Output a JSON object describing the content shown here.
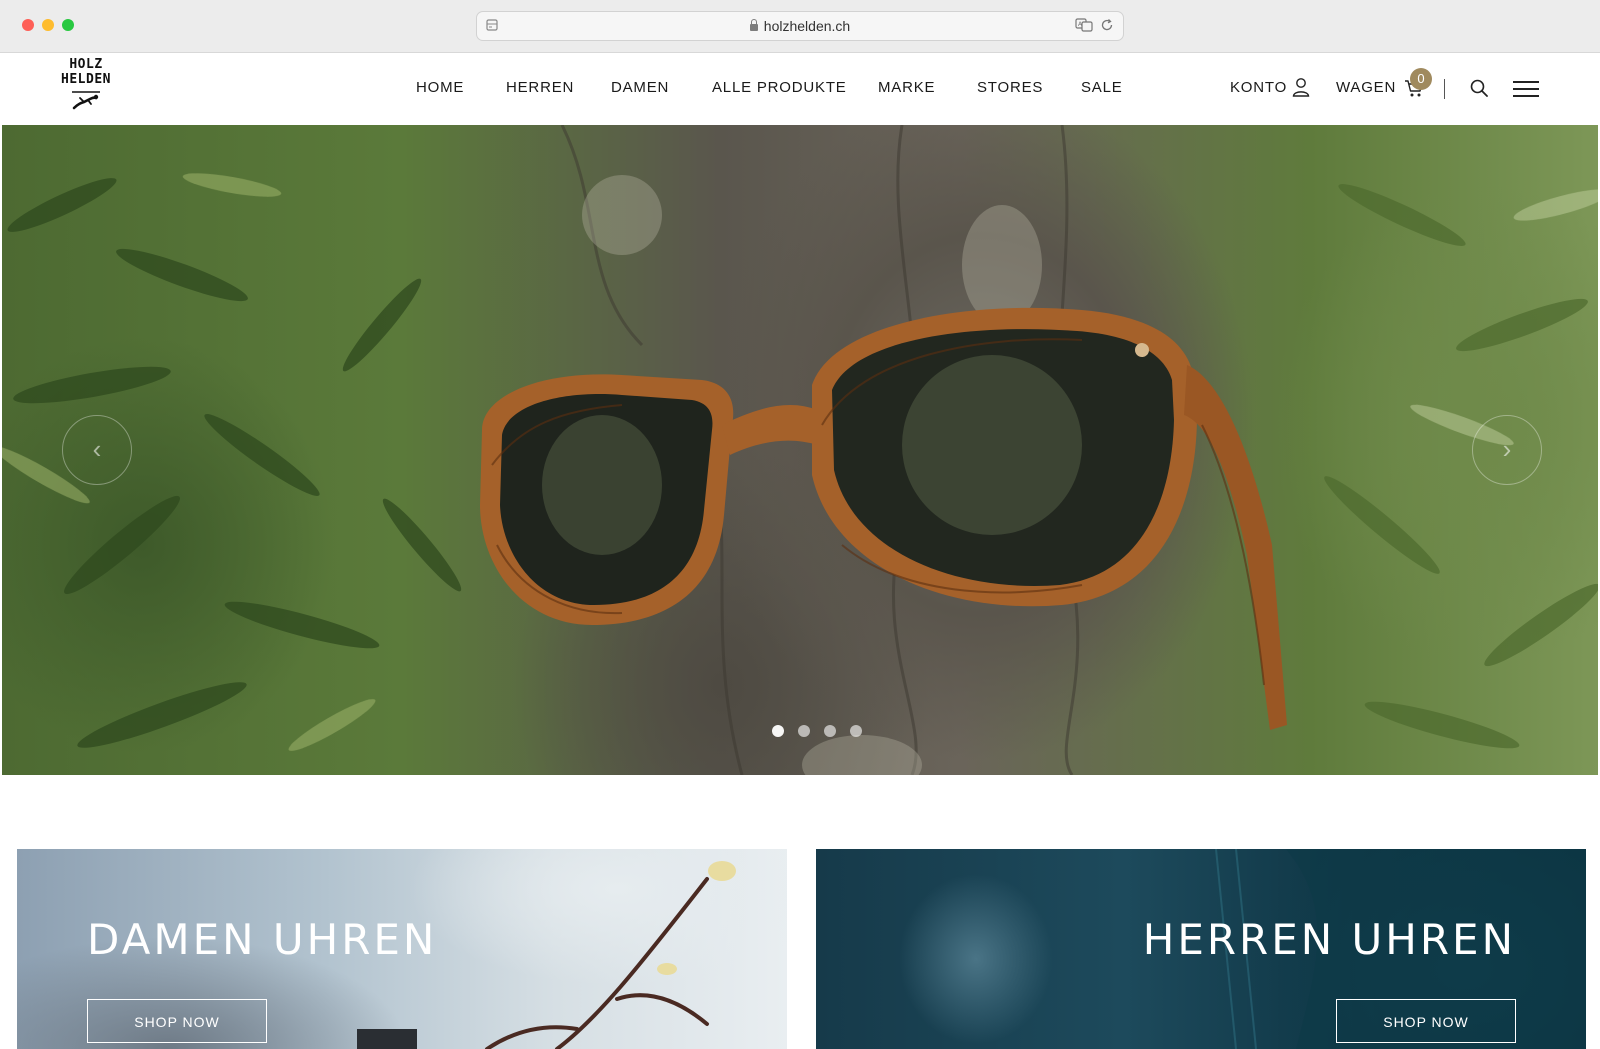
{
  "browser": {
    "url": "holzhelden.ch"
  },
  "logo": {
    "line1": "HOLZ",
    "line2": "HELDEN"
  },
  "nav": {
    "items": [
      {
        "label": "HOME"
      },
      {
        "label": "HERREN"
      },
      {
        "label": "DAMEN"
      },
      {
        "label": "ALLE PRODUKTE"
      },
      {
        "label": "MARKE"
      },
      {
        "label": "STORES"
      },
      {
        "label": "SALE"
      }
    ]
  },
  "account": {
    "konto_label": "KONTO",
    "wagen_label": "WAGEN",
    "cart_count": "0"
  },
  "hero": {
    "slide_count": 4,
    "active_slide": 1,
    "prev_icon": "chevron-left-icon",
    "next_icon": "chevron-right-icon"
  },
  "banners": [
    {
      "title": "DAMEN UHREN",
      "button": "SHOP NOW"
    },
    {
      "title": "HERREN UHREN",
      "button": "SHOP NOW"
    }
  ],
  "colors": {
    "badge": "#a08a5e",
    "text": "#1a1a1a"
  }
}
